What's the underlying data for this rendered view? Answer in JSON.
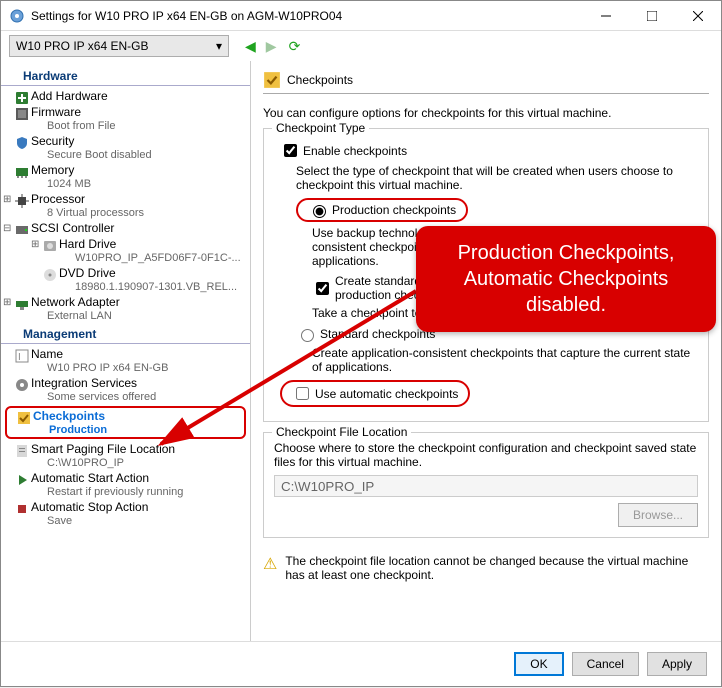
{
  "title": "Settings for W10 PRO IP x64 EN-GB on AGM-W10PRO04",
  "vm_selector": "W10 PRO IP x64 EN-GB",
  "sidebar": {
    "hardware_label": "Hardware",
    "add_hw": "Add Hardware",
    "firmware": "Firmware",
    "firmware_sub": "Boot from File",
    "security": "Security",
    "security_sub": "Secure Boot disabled",
    "memory": "Memory",
    "memory_sub": "1024 MB",
    "processor": "Processor",
    "processor_sub": "8 Virtual processors",
    "scsi": "SCSI Controller",
    "hdd": "Hard Drive",
    "hdd_sub": "W10PRO_IP_A5FD06F7-0F1C-...",
    "dvd": "DVD Drive",
    "dvd_sub": "18980.1.190907-1301.VB_REL...",
    "net": "Network Adapter",
    "net_sub": "External LAN",
    "management_label": "Management",
    "name": "Name",
    "name_sub": "W10 PRO IP x64 EN-GB",
    "integ": "Integration Services",
    "integ_sub": "Some services offered",
    "chk": "Checkpoints",
    "chk_sub": "Production",
    "paging": "Smart Paging File Location",
    "paging_sub": "C:\\W10PRO_IP",
    "start": "Automatic Start Action",
    "start_sub": "Restart if previously running",
    "stop": "Automatic Stop Action",
    "stop_sub": "Save"
  },
  "panel": {
    "heading": "Checkpoints",
    "intro": "You can configure options for checkpoints for this virtual machine.",
    "grp_type": "Checkpoint Type",
    "enable": "Enable checkpoints",
    "type_desc": "Select the type of checkpoint that will be created when users choose to checkpoint this virtual machine.",
    "prod": "Production checkpoints",
    "prod_desc": "Use backup technology in the guest operating system to create data-consistent checkpoints that don't include information about running applications.",
    "create_std": "Create standard checkpoints if it's not possible to create a production checkpoint.",
    "take_desc": "Take a checkpoint technology inside the",
    "std": "Standard checkpoints",
    "std_desc": "Create application-consistent checkpoints that capture the current state of applications.",
    "auto": "Use automatic checkpoints",
    "grp_loc": "Checkpoint File Location",
    "loc_desc": "Choose where to store the checkpoint configuration and checkpoint saved state files for this virtual machine.",
    "loc_path": "C:\\W10PRO_IP",
    "browse": "Browse...",
    "warn": "The checkpoint file location cannot be changed because the virtual machine has at least one checkpoint."
  },
  "callout": "Production Checkpoints, Automatic Checkpoints disabled.",
  "buttons": {
    "ok": "OK",
    "cancel": "Cancel",
    "apply": "Apply"
  }
}
